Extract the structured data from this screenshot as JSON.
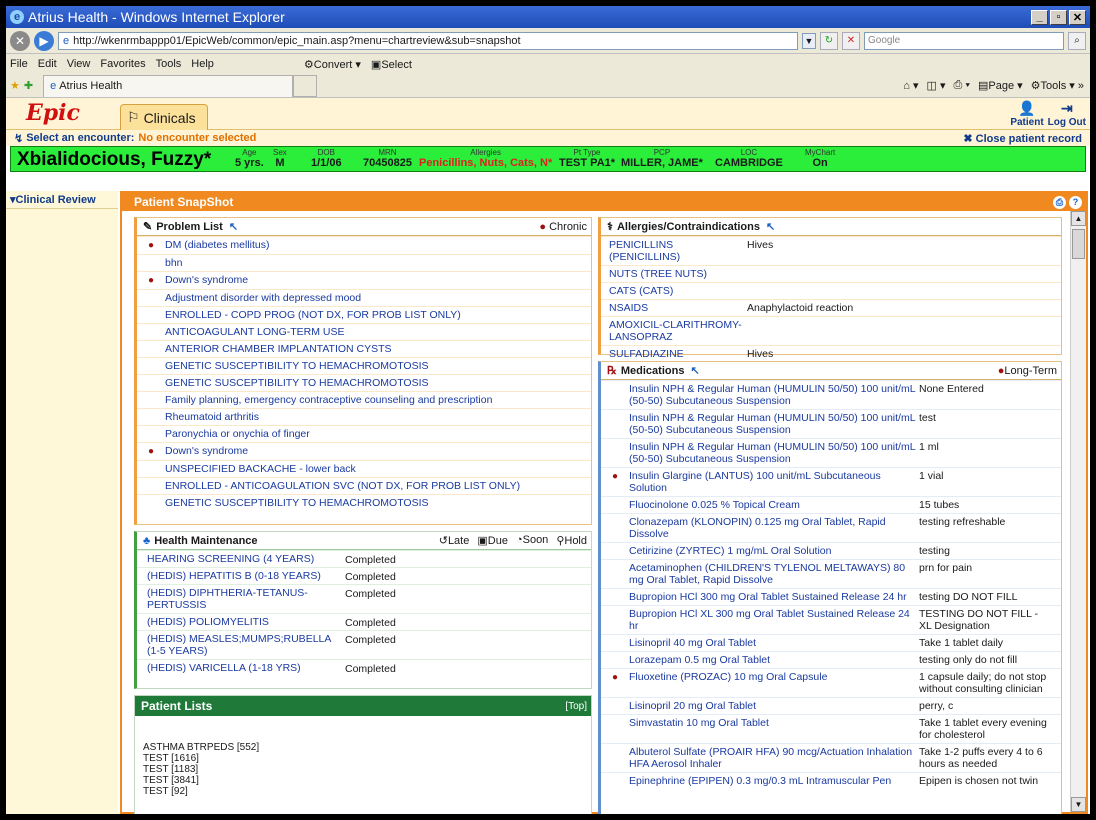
{
  "browser": {
    "title": "Atrius Health - Windows Internet Explorer",
    "url": "http://wkenrmbappp01/EpicWeb/common/epic_main.asp?menu=chartreview&sub=snapshot",
    "search_placeholder": "Google",
    "menu": [
      "File",
      "Edit",
      "View",
      "Favorites",
      "Tools",
      "Help"
    ],
    "convert_label": "Convert",
    "select_label": "Select",
    "tab_label": "Atrius Health",
    "page_label": "Page",
    "tools_label": "Tools"
  },
  "epic": {
    "logo": "Epic",
    "clinicals_tab": "Clinicals",
    "patient_btn": "Patient",
    "logout_btn": "Log Out",
    "encounter_label": "Select an encounter:",
    "encounter_value": "No encounter selected",
    "close_record": "Close patient record"
  },
  "patient": {
    "name": "Xbialidocious, Fuzzy*",
    "age_label": "Age",
    "age": "5 yrs.",
    "sex_label": "Sex",
    "sex": "M",
    "dob_label": "DOB",
    "dob": "1/1/06",
    "mrn_label": "MRN",
    "mrn": "70450825",
    "allergies_label": "Allergies",
    "allergies": "Penicillins, Nuts, Cats, N*",
    "pttype_label": "Pt Type",
    "pttype": "TEST PA1*",
    "pcp_label": "PCP",
    "pcp": "MILLER, JAME*",
    "loc_label": "LOC",
    "loc": "CAMBRIDGE",
    "mychart_label": "MyChart",
    "mychart": "On"
  },
  "leftnav": {
    "clinical_review": "Clinical Review"
  },
  "snapshot": {
    "title": "Patient SnapShot",
    "problem_list": {
      "title": "Problem List",
      "chronic_label": "Chronic",
      "items": [
        {
          "chronic": true,
          "text": "DM (diabetes mellitus)"
        },
        {
          "chronic": false,
          "text": "bhn"
        },
        {
          "chronic": true,
          "text": "Down's syndrome"
        },
        {
          "chronic": false,
          "text": "Adjustment disorder with depressed mood"
        },
        {
          "chronic": false,
          "text": "ENROLLED - COPD PROG (NOT DX, FOR PROB LIST ONLY)"
        },
        {
          "chronic": false,
          "text": "ANTICOAGULANT LONG-TERM USE"
        },
        {
          "chronic": false,
          "text": "ANTERIOR CHAMBER IMPLANTATION CYSTS"
        },
        {
          "chronic": false,
          "text": "GENETIC SUSCEPTIBILITY TO HEMACHROMOTOSIS"
        },
        {
          "chronic": false,
          "text": "GENETIC SUSCEPTIBILITY TO HEMACHROMOTOSIS"
        },
        {
          "chronic": false,
          "text": "Family planning, emergency contraceptive counseling and prescription"
        },
        {
          "chronic": false,
          "text": "Rheumatoid arthritis"
        },
        {
          "chronic": false,
          "text": "Paronychia or onychia of finger"
        },
        {
          "chronic": true,
          "text": "Down's syndrome"
        },
        {
          "chronic": false,
          "text": "UNSPECIFIED BACKACHE - lower back"
        },
        {
          "chronic": false,
          "text": "ENROLLED - ANTICOAGULATION SVC (NOT DX, FOR PROB LIST ONLY)"
        },
        {
          "chronic": false,
          "text": "GENETIC SUSCEPTIBILITY TO HEMACHROMOTOSIS"
        }
      ]
    },
    "health_maintenance": {
      "title": "Health Maintenance",
      "legend": [
        "Late",
        "Due",
        "Soon",
        "Hold"
      ],
      "items": [
        {
          "name": "HEARING SCREENING (4 YEARS)",
          "status": "Completed"
        },
        {
          "name": "(HEDIS) HEPATITIS B (0-18 YEARS)",
          "status": "Completed"
        },
        {
          "name": "(HEDIS) DIPHTHERIA-TETANUS-PERTUSSIS",
          "status": "Completed"
        },
        {
          "name": "(HEDIS) POLIOMYELITIS",
          "status": "Completed"
        },
        {
          "name": "(HEDIS) MEASLES;MUMPS;RUBELLA (1-5 YEARS)",
          "status": "Completed"
        },
        {
          "name": "(HEDIS) VARICELLA (1-18 YRS)",
          "status": "Completed"
        }
      ]
    },
    "patient_lists": {
      "title": "Patient Lists",
      "top_label": "[Top]",
      "items": [
        "ASTHMA BTRPEDS [552]",
        "TEST [1616]",
        "TEST [1183]",
        "TEST [3841]",
        "TEST [92]"
      ]
    },
    "allergies": {
      "title": "Allergies/Contraindications",
      "items": [
        {
          "name": "PENICILLINS (PENICILLINS)",
          "reaction": "Hives"
        },
        {
          "name": "NUTS (TREE NUTS)",
          "reaction": ""
        },
        {
          "name": "CATS (CATS)",
          "reaction": ""
        },
        {
          "name": "NSAIDS",
          "reaction": "Anaphylactoid reaction"
        },
        {
          "name": "AMOXICIL-CLARITHROMY-LANSOPRAZ",
          "reaction": ""
        },
        {
          "name": "SULFADIAZINE",
          "reaction": "Hives"
        }
      ]
    },
    "medications": {
      "title": "Medications",
      "longterm_label": "Long-Term",
      "items": [
        {
          "lt": false,
          "name": "Insulin NPH & Regular Human (HUMULIN 50/50) 100 unit/mL (50-50) Subcutaneous Suspension",
          "sig": "None Entered"
        },
        {
          "lt": false,
          "name": "Insulin NPH & Regular Human (HUMULIN 50/50) 100 unit/mL (50-50) Subcutaneous Suspension",
          "sig": "test"
        },
        {
          "lt": false,
          "name": "Insulin NPH & Regular Human (HUMULIN 50/50) 100 unit/mL (50-50) Subcutaneous Suspension",
          "sig": "1 ml"
        },
        {
          "lt": true,
          "name": "Insulin Glargine (LANTUS) 100 unit/mL Subcutaneous Solution",
          "sig": "1 vial"
        },
        {
          "lt": false,
          "name": "Fluocinolone 0.025 % Topical Cream",
          "sig": "15 tubes"
        },
        {
          "lt": false,
          "name": "Clonazepam (KLONOPIN) 0.125 mg Oral Tablet, Rapid Dissolve",
          "sig": "testing refreshable"
        },
        {
          "lt": false,
          "name": "Cetirizine (ZYRTEC) 1 mg/mL Oral Solution",
          "sig": "testing"
        },
        {
          "lt": false,
          "name": "Acetaminophen (CHILDREN'S TYLENOL MELTAWAYS) 80 mg Oral Tablet, Rapid Dissolve",
          "sig": "prn for pain"
        },
        {
          "lt": false,
          "name": "Bupropion HCl 300 mg Oral Tablet Sustained Release 24 hr",
          "sig": "testing DO NOT FILL"
        },
        {
          "lt": false,
          "name": "Bupropion HCl XL 300 mg Oral Tablet Sustained Release 24 hr",
          "sig": "TESTING DO NOT FILL - XL Designation"
        },
        {
          "lt": false,
          "name": "Lisinopril 40 mg Oral Tablet",
          "sig": "Take 1 tablet daily"
        },
        {
          "lt": false,
          "name": "Lorazepam 0.5 mg Oral Tablet",
          "sig": "testing only do not fill"
        },
        {
          "lt": true,
          "name": "Fluoxetine (PROZAC) 10 mg Oral Capsule",
          "sig": "1 capsule daily; do not stop without consulting clinician"
        },
        {
          "lt": false,
          "name": "Lisinopril 20 mg Oral Tablet",
          "sig": "perry, c"
        },
        {
          "lt": false,
          "name": "Simvastatin 10 mg Oral Tablet",
          "sig": "Take 1 tablet every evening for cholesterol"
        },
        {
          "lt": false,
          "name": "Albuterol Sulfate (PROAIR HFA) 90 mcg/Actuation Inhalation HFA Aerosol Inhaler",
          "sig": "Take 1-2 puffs every 4 to 6 hours as needed"
        },
        {
          "lt": false,
          "name": "Epinephrine (EPIPEN) 0.3 mg/0.3 mL Intramuscular Pen",
          "sig": "Epipen is chosen not twin"
        }
      ]
    }
  }
}
